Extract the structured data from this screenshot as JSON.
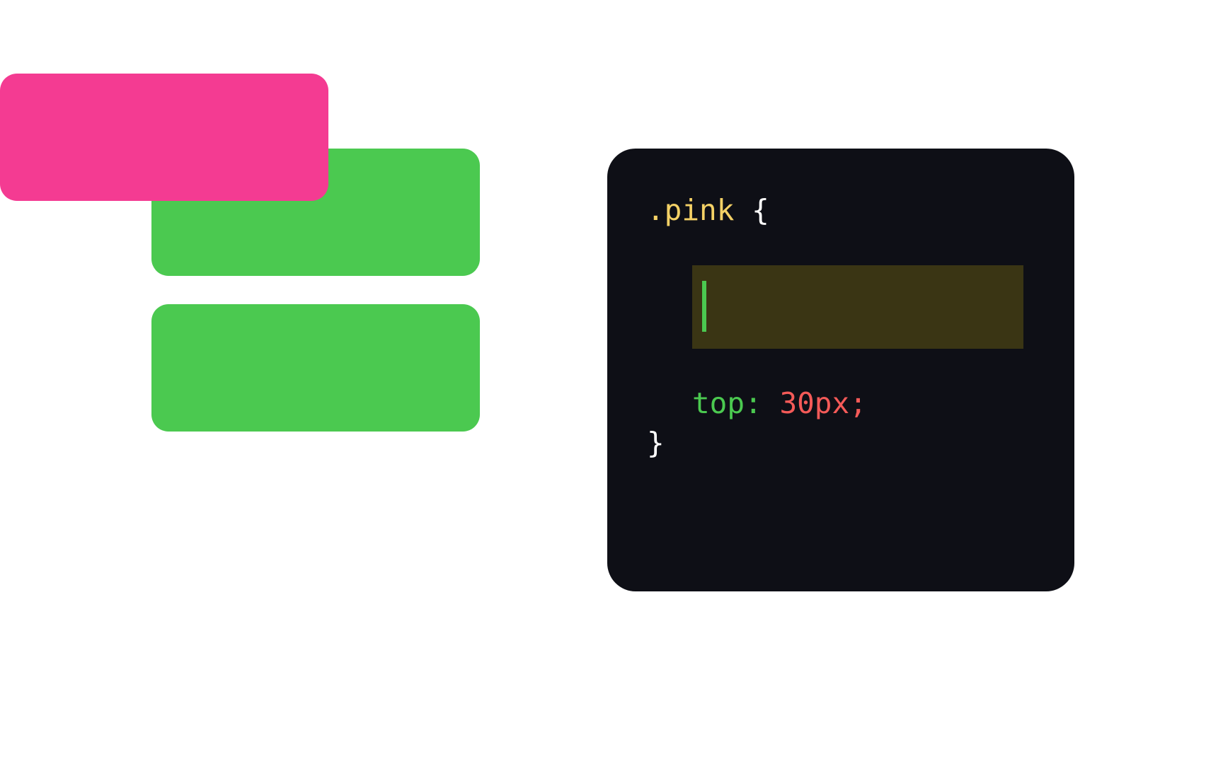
{
  "colors": {
    "pink": "#f43b92",
    "green": "#4bc950",
    "editor_bg": "#0e0f16",
    "selector": "#f4d166",
    "property": "#4bc950",
    "value": "#f45a58",
    "input_bg": "#3a3514"
  },
  "code": {
    "selector": ".pink",
    "brace_open": "{",
    "brace_close": "}",
    "input_value": "",
    "prop2_name": "top:",
    "prop2_value": "30px;"
  }
}
